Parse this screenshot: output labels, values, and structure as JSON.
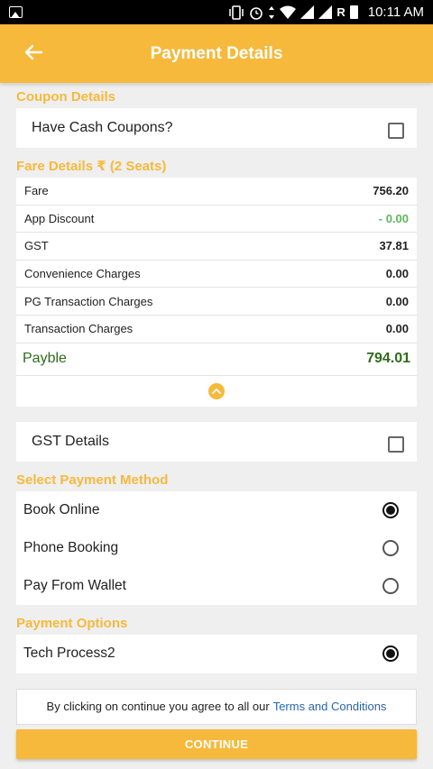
{
  "status_bar": {
    "time": "10:11 AM",
    "carrier_indicator": "R",
    "icons": [
      "image-icon",
      "vibrate-icon",
      "alarm-icon",
      "wifi-icon",
      "signal-icon",
      "signal-icon",
      "battery-icon"
    ]
  },
  "app_bar": {
    "title": "Payment Details",
    "back_icon": "arrow-left-icon"
  },
  "coupon": {
    "section_title": "Coupon Details",
    "label": "Have Cash Coupons?",
    "checked": false
  },
  "fare": {
    "section_title": "Fare Details ₹ (2 Seats)",
    "rows": [
      {
        "label": "Fare",
        "value": "756.20"
      },
      {
        "label": "App Discount",
        "value": "- 0.00"
      },
      {
        "label": "GST",
        "value": "37.81"
      },
      {
        "label": "Convenience Charges",
        "value": "0.00"
      },
      {
        "label": "PG Transaction Charges",
        "value": "0.00"
      },
      {
        "label": "Transaction Charges",
        "value": "0.00"
      }
    ],
    "payable_label": "Payble",
    "payable_value": "794.01"
  },
  "gst": {
    "label": "GST Details",
    "checked": false
  },
  "payment_method": {
    "section_title": "Select Payment Method",
    "options": [
      {
        "label": "Book Online",
        "selected": true
      },
      {
        "label": "Phone Booking",
        "selected": false
      },
      {
        "label": "Pay From Wallet",
        "selected": false
      }
    ]
  },
  "payment_options": {
    "section_title": "Payment Options",
    "options": [
      {
        "label": "Tech Process2",
        "selected": true
      }
    ]
  },
  "terms": {
    "text": "By clicking on continue you agree to all our",
    "link": "Terms and Conditions"
  },
  "continue_label": "CONTINUE",
  "colors": {
    "accent": "#f6b93b",
    "discount_green": "#5cb85c",
    "payable_green": "#2e6b1a",
    "link_blue": "#2a64b0"
  }
}
